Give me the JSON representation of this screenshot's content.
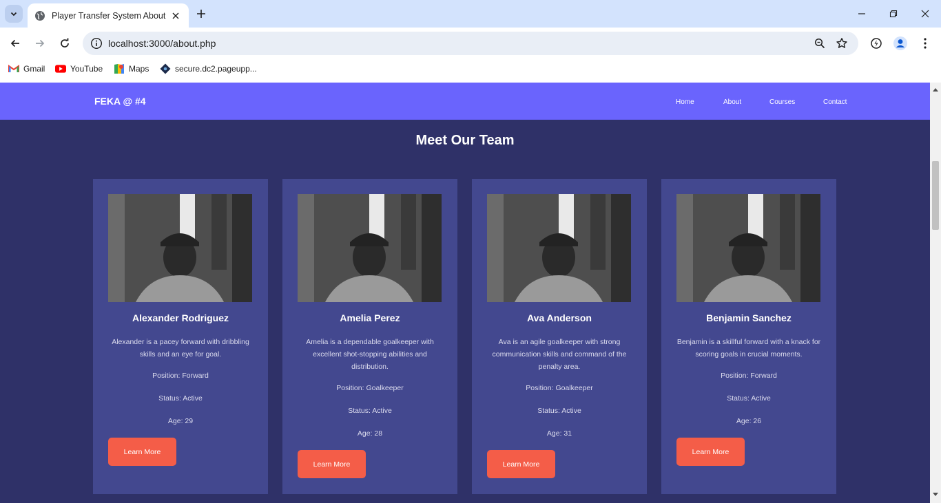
{
  "browser": {
    "tab_title": "Player Transfer System About",
    "url": "localhost:3000/about.php",
    "bookmarks": [
      {
        "label": "Gmail"
      },
      {
        "label": "YouTube"
      },
      {
        "label": "Maps"
      },
      {
        "label": "secure.dc2.pageupp..."
      }
    ]
  },
  "site": {
    "brand": "FEKA @ #4",
    "nav": [
      "Home",
      "About",
      "Courses",
      "Contact"
    ],
    "header_color": "#6a64fd",
    "accent_color": "#f45d48"
  },
  "team": {
    "title": "Meet Our Team",
    "members": [
      {
        "name": "Alexander Rodriguez",
        "description": "Alexander is a pacey forward with dribbling skills and an eye for goal.",
        "position": "Position: Forward",
        "status": "Status: Active",
        "age": "Age: 29",
        "button": "Learn More"
      },
      {
        "name": "Amelia Perez",
        "description": "Amelia is a dependable goalkeeper with excellent shot-stopping abilities and distribution.",
        "position": "Position: Goalkeeper",
        "status": "Status: Active",
        "age": "Age: 28",
        "button": "Learn More"
      },
      {
        "name": "Ava Anderson",
        "description": "Ava is an agile goalkeeper with strong communication skills and command of the penalty area.",
        "position": "Position: Goalkeeper",
        "status": "Status: Active",
        "age": "Age: 31",
        "button": "Learn More"
      },
      {
        "name": "Benjamin Sanchez",
        "description": "Benjamin is a skillful forward with a knack for scoring goals in crucial moments.",
        "position": "Position: Forward",
        "status": "Status: Active",
        "age": "Age: 26",
        "button": "Learn More"
      }
    ]
  }
}
